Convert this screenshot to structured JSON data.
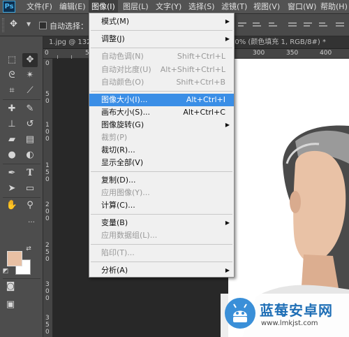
{
  "app": {
    "logo": "Ps"
  },
  "menubar": {
    "items": [
      {
        "label": "文件(F)"
      },
      {
        "label": "编辑(E)"
      },
      {
        "label": "图像(I)"
      },
      {
        "label": "图层(L)"
      },
      {
        "label": "文字(Y)"
      },
      {
        "label": "选择(S)"
      },
      {
        "label": "滤镜(T)"
      },
      {
        "label": "视图(V)"
      },
      {
        "label": "窗口(W)"
      },
      {
        "label": "帮助(H)"
      }
    ]
  },
  "options": {
    "auto_select_label": "自动选择："
  },
  "tabs": {
    "doc_left": "1.jpg @ 132",
    "doc_right": "00% (颜色填充 1, RGB/8#) *"
  },
  "rulers": {
    "top_labels": [
      "0",
      "50",
      "100",
      "150",
      "200",
      "250",
      "300",
      "350",
      "400"
    ],
    "left_labels": [
      "0",
      "5",
      "0",
      "1",
      "0",
      "0",
      "1",
      "5",
      "0",
      "2",
      "0",
      "0",
      "2",
      "5",
      "0",
      "3",
      "0",
      "0",
      "3",
      "5",
      "0"
    ]
  },
  "image_menu": {
    "items": [
      {
        "label": "模式(M)",
        "shortcut": "",
        "submenu": true,
        "disabled": false
      },
      {
        "label": "调整(J)",
        "shortcut": "",
        "submenu": true,
        "disabled": false
      },
      {
        "label": "自动色调(N)",
        "shortcut": "Shift+Ctrl+L",
        "submenu": false,
        "disabled": true
      },
      {
        "label": "自动对比度(U)",
        "shortcut": "Alt+Shift+Ctrl+L",
        "submenu": false,
        "disabled": true
      },
      {
        "label": "自动颜色(O)",
        "shortcut": "Shift+Ctrl+B",
        "submenu": false,
        "disabled": true
      },
      {
        "label": "图像大小(I)...",
        "shortcut": "Alt+Ctrl+I",
        "submenu": false,
        "disabled": false,
        "highlighted": true
      },
      {
        "label": "画布大小(S)...",
        "shortcut": "Alt+Ctrl+C",
        "submenu": false,
        "disabled": false
      },
      {
        "label": "图像旋转(G)",
        "shortcut": "",
        "submenu": true,
        "disabled": false
      },
      {
        "label": "裁剪(P)",
        "shortcut": "",
        "submenu": false,
        "disabled": true
      },
      {
        "label": "裁切(R)...",
        "shortcut": "",
        "submenu": false,
        "disabled": false
      },
      {
        "label": "显示全部(V)",
        "shortcut": "",
        "submenu": false,
        "disabled": false
      },
      {
        "label": "复制(D)...",
        "shortcut": "",
        "submenu": false,
        "disabled": false
      },
      {
        "label": "应用图像(Y)...",
        "shortcut": "",
        "submenu": false,
        "disabled": true
      },
      {
        "label": "计算(C)...",
        "shortcut": "",
        "submenu": false,
        "disabled": false
      },
      {
        "label": "变量(B)",
        "shortcut": "",
        "submenu": true,
        "disabled": false
      },
      {
        "label": "应用数据组(L)...",
        "shortcut": "",
        "submenu": false,
        "disabled": true
      },
      {
        "label": "陷印(T)...",
        "shortcut": "",
        "submenu": false,
        "disabled": true
      },
      {
        "label": "分析(A)",
        "shortcut": "",
        "submenu": true,
        "disabled": false
      }
    ]
  },
  "tools": [
    {
      "icon": "move-tool-icon",
      "glyph": "✥"
    },
    {
      "icon": "marquee-tool-icon",
      "glyph": "⬚"
    },
    {
      "icon": "lasso-tool-icon",
      "glyph": "ᘓ"
    },
    {
      "icon": "magic-wand-tool-icon",
      "glyph": "✴"
    },
    {
      "icon": "crop-tool-icon",
      "glyph": "⌗"
    },
    {
      "icon": "eyedropper-tool-icon",
      "glyph": "⟋"
    },
    {
      "icon": "healing-brush-tool-icon",
      "glyph": "✚"
    },
    {
      "icon": "brush-tool-icon",
      "glyph": "✎"
    },
    {
      "icon": "clone-stamp-tool-icon",
      "glyph": "⊥"
    },
    {
      "icon": "history-brush-tool-icon",
      "glyph": "↺"
    },
    {
      "icon": "eraser-tool-icon",
      "glyph": "▰"
    },
    {
      "icon": "gradient-tool-icon",
      "glyph": "▤"
    },
    {
      "icon": "blur-tool-icon",
      "glyph": "●"
    },
    {
      "icon": "dodge-tool-icon",
      "glyph": "◐"
    },
    {
      "icon": "pen-tool-icon",
      "glyph": "✒"
    },
    {
      "icon": "type-tool-icon",
      "glyph": "T"
    },
    {
      "icon": "path-selection-tool-icon",
      "glyph": "➤"
    },
    {
      "icon": "rectangle-tool-icon",
      "glyph": "▭"
    },
    {
      "icon": "hand-tool-icon",
      "glyph": "✋"
    },
    {
      "icon": "zoom-tool-icon",
      "glyph": "⚲"
    },
    {
      "icon": "quick-mask-icon",
      "glyph": "◙"
    },
    {
      "icon": "screen-mode-icon",
      "glyph": "▣"
    }
  ],
  "watermark": {
    "title": "蓝莓安卓网",
    "url": "www.lmkjst.com"
  },
  "colors": {
    "foreground": "#e8c0a4",
    "background": "#ffffff",
    "highlight": "#3a8ee6",
    "brand": "#1f6fb6"
  }
}
